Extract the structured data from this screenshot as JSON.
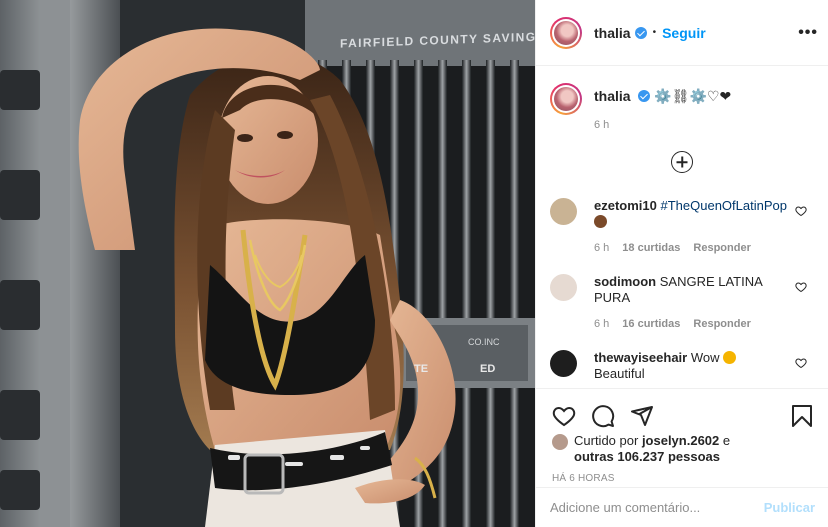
{
  "photo": {
    "vault_sign": "FAIRFIELD COUNTY SAVINGS",
    "plaque_line1": "CO.INC",
    "plaque_line2": "TE",
    "plaque_line3": "ED"
  },
  "header": {
    "username": "thalia",
    "separator": "•",
    "follow_label": "Seguir",
    "more_label": "•••"
  },
  "caption": {
    "username": "thalia",
    "text": "⚙️⛓⚙️♡❤",
    "time": "6 h"
  },
  "comments": [
    {
      "username": "ezetomi10",
      "text": "#TheQuenOfLatinPop",
      "time": "6 h",
      "likes": "18 curtidas",
      "reply": "Responder"
    },
    {
      "username": "sodimoon",
      "text": "SANGRE LATINA PURA",
      "time": "6 h",
      "likes": "16 curtidas",
      "reply": "Responder"
    },
    {
      "username": "thewayiseehair",
      "text": "Wow",
      "text2": "Beautiful"
    }
  ],
  "likes": {
    "prefix": "Curtido por",
    "user": "joselyn.2602",
    "suffix": "e",
    "others": "outras 106.237 pessoas"
  },
  "posted": "HÁ 6 HORAS",
  "add_comment": {
    "placeholder": "Adicione um comentário...",
    "publish_label": "Publicar"
  },
  "colors": {
    "accent": "#0095f6",
    "publish_disabled": "#b2dffc",
    "muted": "#8e8e8e"
  }
}
